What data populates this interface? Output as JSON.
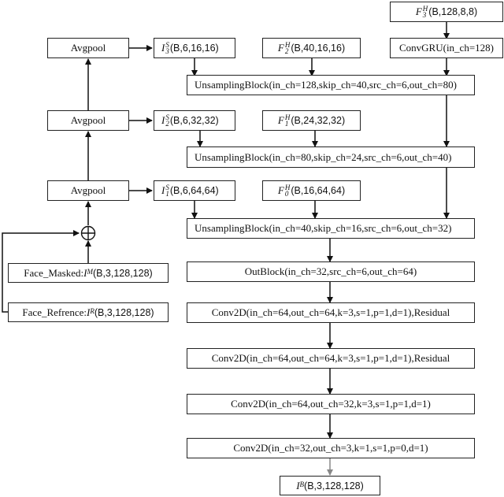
{
  "diagram": {
    "left_column": {
      "avgpool_blocks": [
        "Avgpool",
        "Avgpool",
        "Avgpool"
      ],
      "source_tensors": [
        {
          "base": "I",
          "sup": "S",
          "sub": "3",
          "shape": "(B,6,16,16)"
        },
        {
          "base": "I",
          "sup": "S",
          "sub": "2",
          "shape": "(B,6,32,32)"
        },
        {
          "base": "I",
          "sup": "S",
          "sub": "1",
          "shape": "(B,6,64,64)"
        }
      ],
      "sum_symbol": "⊕",
      "face_masked": {
        "prefix": "Face_Masked:",
        "base": "I",
        "sup": "M",
        "shape": "(B,3,128,128)"
      },
      "face_reference": {
        "prefix": "Face_Refrence:",
        "base": "I",
        "sup": "R",
        "shape": "(B,3,128,128)"
      }
    },
    "features": [
      {
        "base": "F",
        "sup": "H",
        "sub": "3",
        "shape": "(B,128,8,8)"
      },
      {
        "base": "F",
        "sup": "H",
        "sub": "2",
        "shape": "(B,40,16,16)"
      },
      {
        "base": "F",
        "sup": "H",
        "sub": "1",
        "shape": "(B,24,32,32)"
      },
      {
        "base": "F",
        "sup": "H",
        "sub": "0",
        "shape": "(B,16,64,64)"
      }
    ],
    "convgru": "ConvGRU(in_ch=128)",
    "upsampling_blocks": [
      "UnsamplingBlock(in_ch=128,skip_ch=40,src_ch=6,out_ch=80)",
      "UnsamplingBlock(in_ch=80,skip_ch=24,src_ch=6,out_ch=40)",
      "UnsamplingBlock(in_ch=40,skip_ch=16,src_ch=6,out_ch=32)"
    ],
    "outblock": "OutBlock(in_ch=32,src_ch=6,out_ch=64)",
    "conv_layers": [
      "Conv2D(in_ch=64,out_ch=64,k=3,s=1,p=1,d=1),Residual",
      "Conv2D(in_ch=64,out_ch=64,k=3,s=1,p=1,d=1),Residual",
      "Conv2D(in_ch=64,out_ch=32,k=3,s=1,p=1,d=1)",
      "Conv2D(in_ch=32,out_ch=3,k=1,s=1,p=0,d=1)"
    ],
    "output": {
      "base": "I",
      "sup": "B",
      "shape": "(B,3,128,128)"
    },
    "colors": {
      "line": "#111111",
      "final_arrow": "#888888"
    }
  }
}
